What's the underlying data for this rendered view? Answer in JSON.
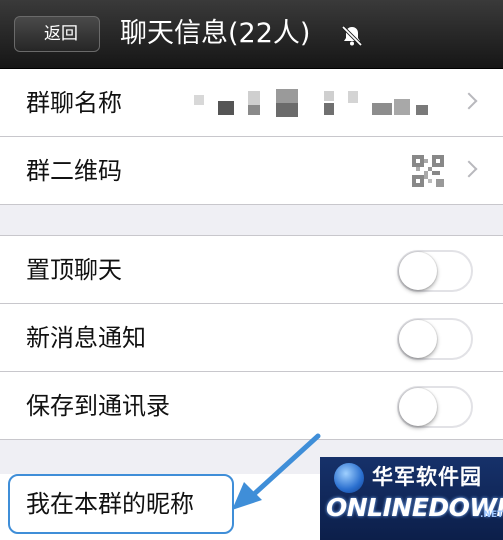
{
  "navbar": {
    "back_label": "返回",
    "title": "聊天信息(22人)",
    "mute_icon": "bell-off-icon"
  },
  "rows": {
    "group_name_label": "群聊名称",
    "qr_label": "群二维码",
    "pin_label": "置顶聊天",
    "notify_label": "新消息通知",
    "save_contacts_label": "保存到通讯录",
    "nickname_label": "我在本群的昵称"
  },
  "toggles": {
    "pin_on": false,
    "notify_on": false,
    "save_contacts_on": false
  },
  "watermark": {
    "cn": "华军软件园",
    "en": "ONLINEDOWN",
    "suffix": ".NET"
  },
  "colors": {
    "navbar": "#1e1e1e",
    "background": "#efeff4",
    "callout_border": "#3f8ed8",
    "watermark_bg": "#16316a"
  }
}
